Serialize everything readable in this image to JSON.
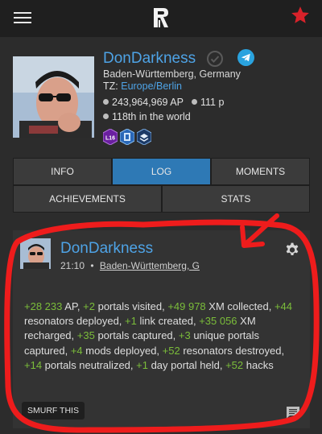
{
  "topbar": {
    "menu_icon": "hamburger-icon",
    "logo_icon": "app-logo-icon",
    "favorite_icon": "star-icon",
    "favorite_color": "#d8222a"
  },
  "profile": {
    "username": "DonDarkness",
    "location": "Baden-Württemberg, Germany",
    "tz_label": "TZ:",
    "tz_value": "Europe/Berlin",
    "ap": "243,964,969 AP",
    "level": "111 p",
    "rank": "118th in the world",
    "badges": [
      "L16",
      "medal",
      "medal"
    ]
  },
  "tabs": [
    {
      "label": "INFO"
    },
    {
      "label": "LOG",
      "active": true
    },
    {
      "label": "MOMENTS"
    },
    {
      "label": "ACHIEVEMENTS"
    },
    {
      "label": "STATS"
    }
  ],
  "post": {
    "username": "DonDarkness",
    "time": "21:10",
    "separator": "•",
    "location": "Baden-Württemberg, G",
    "segments": [
      [
        "+28 233",
        true
      ],
      [
        " AP, ",
        false
      ],
      [
        "+2",
        true
      ],
      [
        " portals visited, ",
        false
      ],
      [
        "+49 978",
        true
      ],
      [
        " XM collected, ",
        false
      ],
      [
        "+44",
        true
      ],
      [
        " resonators deployed, ",
        false
      ],
      [
        "+1",
        true
      ],
      [
        " link created, ",
        false
      ],
      [
        "+35 056",
        true
      ],
      [
        " XM recharged, ",
        false
      ],
      [
        "+35",
        true
      ],
      [
        " portals captured, ",
        false
      ],
      [
        "+3",
        true
      ],
      [
        " unique portals captured, ",
        false
      ],
      [
        "+4",
        true
      ],
      [
        " mods deployed, ",
        false
      ],
      [
        "+52",
        true
      ],
      [
        " resonators destroyed, ",
        false
      ],
      [
        "+14",
        true
      ],
      [
        " portals neutralized, ",
        false
      ],
      [
        "+1",
        true
      ],
      [
        " day portal held, ",
        false
      ],
      [
        "+52",
        true
      ],
      [
        " hacks",
        false
      ]
    ],
    "smurf_label": "SMURF THIS",
    "accent_green": "#7bbd3a"
  },
  "accent_blue": "#4ea3e6",
  "annotation_color": "#ee1c1c"
}
